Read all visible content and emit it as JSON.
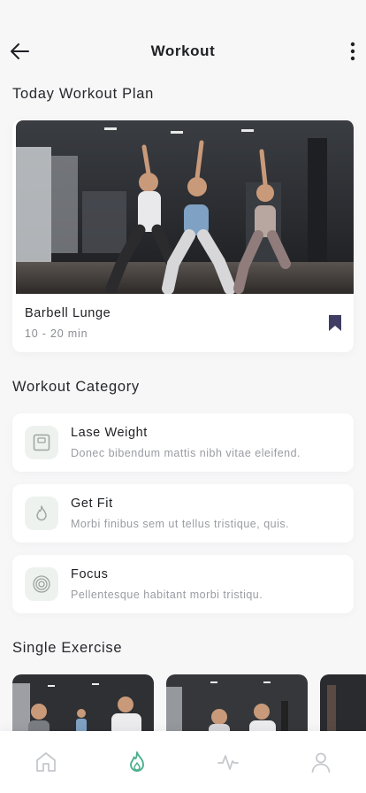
{
  "header": {
    "title": "Workout"
  },
  "today": {
    "section_title": "Today Workout Plan",
    "plan_name": "Barbell Lunge",
    "duration": "10 - 20 min"
  },
  "category": {
    "section_title": "Workout Category",
    "items": [
      {
        "title": "Lase Weight",
        "desc": "Donec bibendum mattis nibh vitae eleifend.",
        "icon": "scale-icon"
      },
      {
        "title": "Get Fit",
        "desc": "Morbi finibus sem ut tellus tristique, quis.",
        "icon": "flame-icon"
      },
      {
        "title": "Focus",
        "desc": "Pellentesque habitant morbi tristiqu.",
        "icon": "target-icon"
      }
    ]
  },
  "single": {
    "section_title": "Single Exercise"
  },
  "nav": {
    "items": [
      {
        "icon": "home-icon",
        "active": false
      },
      {
        "icon": "flame-icon",
        "active": true
      },
      {
        "icon": "activity-icon",
        "active": false
      },
      {
        "icon": "user-icon",
        "active": false
      }
    ]
  },
  "colors": {
    "accent": "#4cae8e",
    "bookmark": "#3f3d63",
    "background": "#f7f7f8"
  }
}
